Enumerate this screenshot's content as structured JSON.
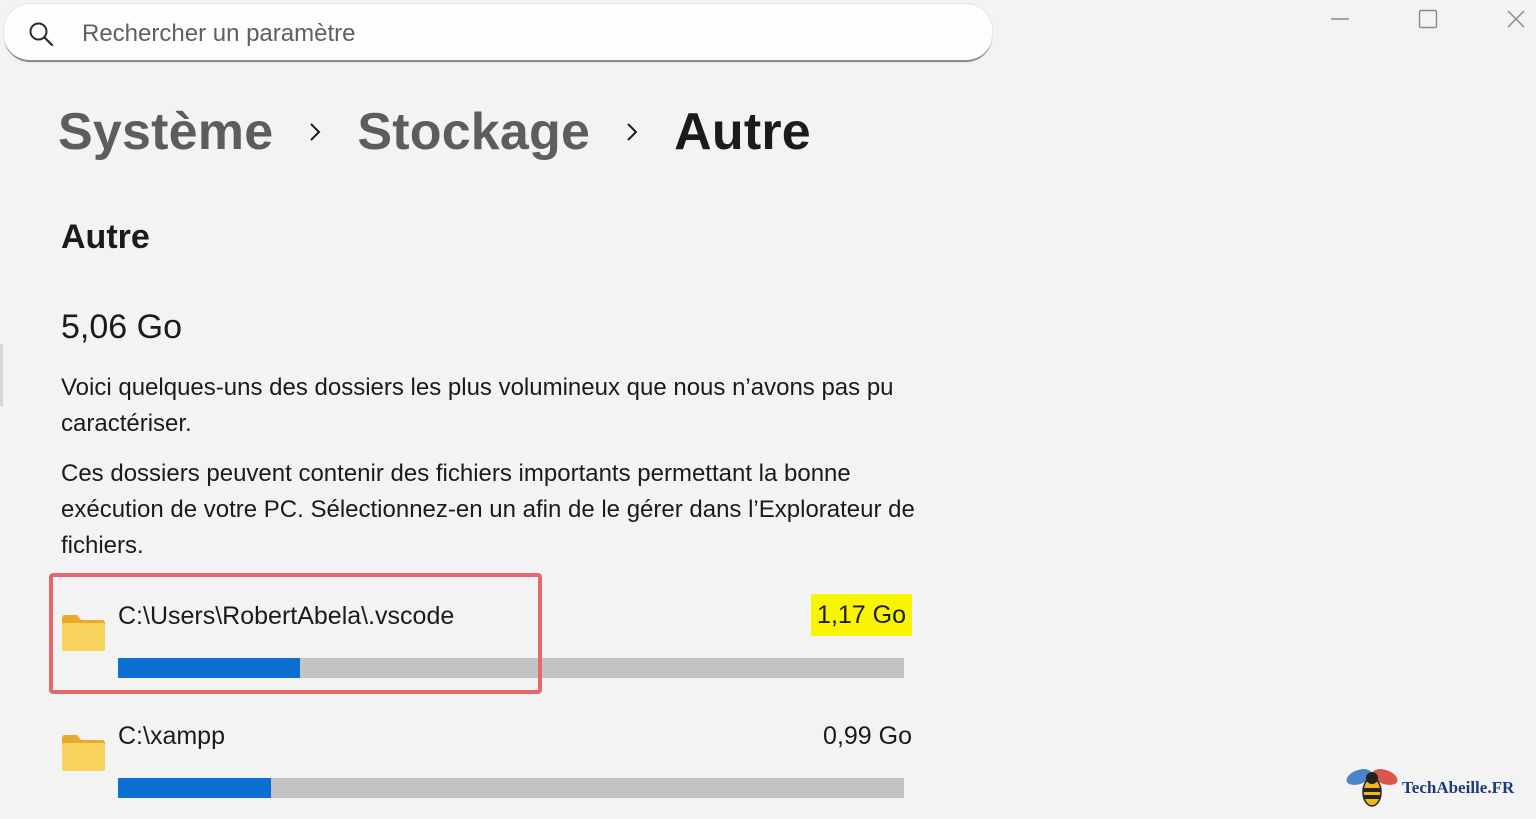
{
  "search": {
    "placeholder": "Rechercher un paramètre"
  },
  "breadcrumb": {
    "items": [
      "Système",
      "Stockage",
      "Autre"
    ]
  },
  "section": {
    "title": "Autre",
    "total_size": "5,06 Go",
    "description_1": "Voici quelques-uns des dossiers les plus volumineux que nous n’avons pas pu caractériser.",
    "description_2": "Ces dossiers peuvent contenir des fichiers importants permettant la bonne exécution de votre PC. Sélectionnez-en un afin de le gérer dans l’Explorateur de fichiers."
  },
  "folders": [
    {
      "path": "C:\\Users\\RobertAbela\\.vscode",
      "size": "1,17 Go",
      "fill_fraction": 0.232,
      "highlighted": true
    },
    {
      "path": "C:\\xampp",
      "size": "0,99 Go",
      "fill_fraction": 0.195,
      "highlighted": false
    }
  ],
  "colors": {
    "background": "#f3f3f3",
    "accent": "#0a6fd0",
    "bar_track": "#c3c3c3",
    "highlight": "#f9f400",
    "callout_border": "#e8676e",
    "folder": "#f6c64a"
  },
  "icons": {
    "search": "search-icon",
    "minimize": "minimize-icon",
    "maximize": "maximize-icon",
    "close": "close-icon",
    "chevron": "chevron-right-icon",
    "folder": "folder-icon"
  },
  "watermark": {
    "text": "TechAbeille.FR"
  }
}
